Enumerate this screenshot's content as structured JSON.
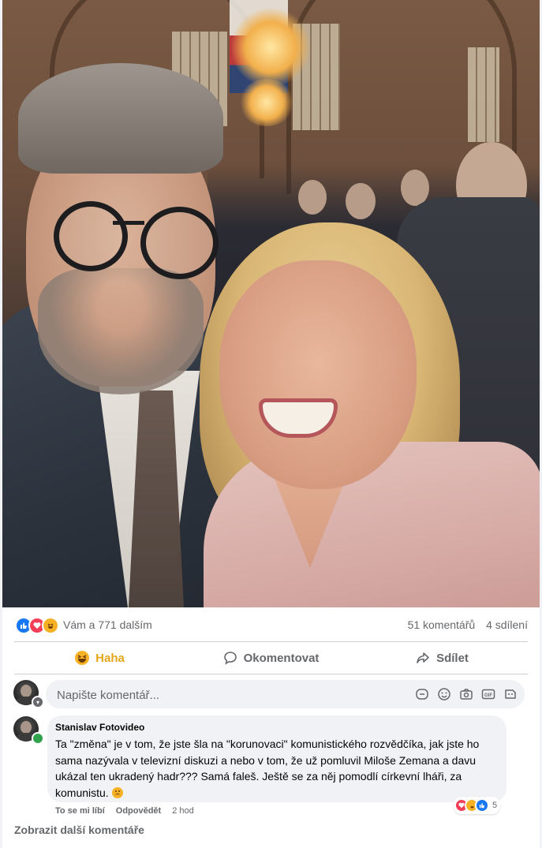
{
  "post": {
    "photo_icon": "selfie-photo",
    "reactions": {
      "icons": [
        "like-icon",
        "love-icon",
        "haha-icon"
      ],
      "summary": "Vám a 771 dalším",
      "comments_count": "51 komentářů",
      "shares_count": "4 sdílení"
    },
    "actions": {
      "react_label": "Haha",
      "comment_label": "Okomentovat",
      "share_label": "Sdílet"
    }
  },
  "composer": {
    "placeholder": "Napište komentář...",
    "tools": [
      "sticker-icon",
      "emoji-icon",
      "camera-icon",
      "gif-icon",
      "avatar-sticker-icon"
    ]
  },
  "comment": {
    "author": "Stanislav Fotovideo",
    "text": "Ta \"změna\" je v tom, že jste šla na \"korunovaci\" komunistického rozvědčíka, jak jste ho sama nazývala v televizní diskuzi a nebo v tom, že už pomluvil Miloše Zemana a davu ukázal ten ukradený hadr??? Samá faleš. Ještě se za něj pomodlí církevní lháři, za komunistu.",
    "like_label": "To se mi líbí",
    "reply_label": "Odpovědět",
    "time": "2 hod",
    "reaction_count": "5"
  },
  "more_comments_label": "Zobrazit další komentáře",
  "colors": {
    "like": "#1877f2",
    "love": "#f33e58",
    "haha": "#f7b125",
    "muted_text": "#65676b",
    "bubble": "#f0f2f5"
  }
}
